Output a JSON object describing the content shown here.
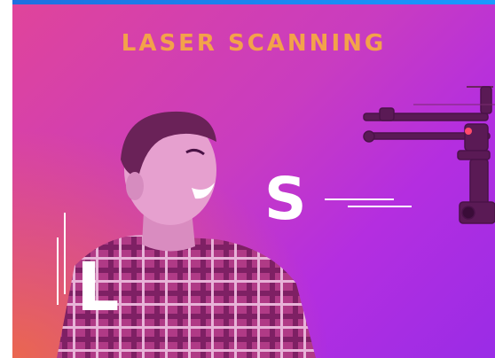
{
  "banner": {
    "headline": "LASER SCANNING",
    "letter_s": "S",
    "letter_l": "L"
  },
  "colors": {
    "accent_orange": "#f3a24a",
    "top_bar_blue": "#1a9aff",
    "gradient_pink": "#e0449a",
    "gradient_purple": "#9a2ce6"
  },
  "images": {
    "person": "smiling-man-photo",
    "drone": "drone-photo"
  }
}
